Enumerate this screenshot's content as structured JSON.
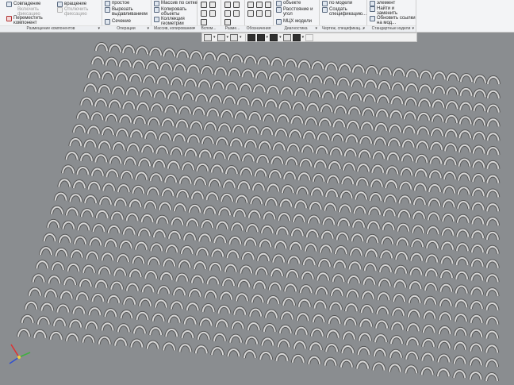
{
  "ribbon": {
    "groups": [
      {
        "footer": "Размещение компонентов",
        "cmds": {
          "c0": "",
          "c1": "Совпадение",
          "c2": "Переместить компонент",
          "c3": "вращение",
          "c4": "Включить фиксацию",
          "c5": "Отключить фиксацию"
        }
      },
      {
        "footer": "Операции",
        "cmds": {
          "c1": "простое",
          "c2": "Вырезать выдавливанием",
          "c3": "Сечение"
        }
      },
      {
        "footer": "Массив, копирование",
        "cmds": {
          "c1": "Массив по сетке",
          "c2": "Копировать объекты",
          "c3": "Коллекция геометрии"
        }
      },
      {
        "footer": "Вспом..."
      },
      {
        "footer": "Разме..."
      },
      {
        "footer": "Обозначения"
      },
      {
        "footer": "Диагностика",
        "cmds": {
          "c1": "объекте",
          "c2": "Расстояние и угол",
          "c3": "МЦХ модели"
        }
      },
      {
        "footer": "Чертеж, спецификац...",
        "cmds": {
          "c1": "по модели",
          "c2": "Создать спецификацию..."
        }
      },
      {
        "footer": "Стандартные издели",
        "cmds": {
          "c1": "элемент",
          "c2": "Найти и заменить",
          "c3": "Обновить ссылки на мод..."
        }
      }
    ]
  },
  "toolbar": {
    "buttons": [
      "view-orient",
      "zoom",
      "rotate",
      "box",
      "render-style",
      "section",
      "hide",
      "filter",
      "pin"
    ]
  },
  "viewport": {
    "background": "#8a8d90",
    "mesh": {
      "rows": 22,
      "cols": 30,
      "color": "#d8d8d8",
      "shadow": "#555555"
    }
  },
  "axes": {
    "x_color": "#e03030",
    "y_color": "#40b040",
    "z_color": "#3050d0"
  }
}
